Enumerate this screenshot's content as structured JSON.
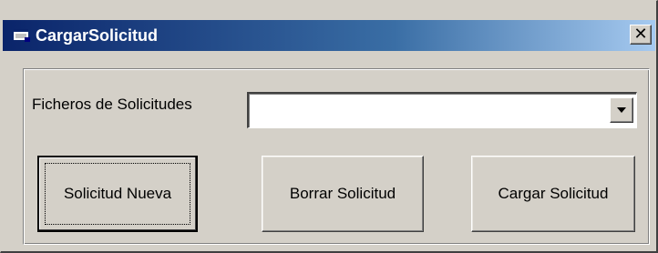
{
  "window": {
    "title": "CargarSolicitud",
    "close_label": "✕"
  },
  "form": {
    "files_label": "Ficheros de Solicitudes",
    "files_combo_value": ""
  },
  "buttons": {
    "new_request": "Solicitud Nueva",
    "delete_request": "Borrar Solicitud",
    "load_request": "Cargar Solicitud"
  },
  "icons": {
    "app": "app-window-icon",
    "close": "close-icon",
    "dropdown": "chevron-down-icon"
  },
  "colors": {
    "face": "#d4d0c8",
    "title_start": "#0a246a",
    "title_end": "#a6caf0"
  }
}
